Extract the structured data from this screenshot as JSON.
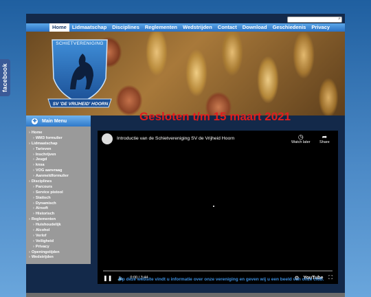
{
  "social": {
    "facebook_label": "facebook"
  },
  "search": {
    "placeholder": ""
  },
  "nav": {
    "items": [
      "Home",
      "Lidmaatschap",
      "Disciplines",
      "Reglementen",
      "Wedstrijden",
      "Contact",
      "Download",
      "Geschiedenis",
      "Privacy"
    ],
    "active": "Home"
  },
  "crest": {
    "top_text": "SCHIETVERENIGING",
    "ribbon_text": "SV 'DE VRIJHEID' HOORN"
  },
  "sidebar": {
    "title": "Main Menu",
    "items": [
      {
        "label": "Home",
        "level": 0
      },
      {
        "label": "WM3 formulier",
        "level": 1
      },
      {
        "label": "Lidmaatschap",
        "level": 0
      },
      {
        "label": "Tarieven",
        "level": 1
      },
      {
        "label": "Inschrijven",
        "level": 1
      },
      {
        "label": "Jeugd",
        "level": 1
      },
      {
        "label": "knsa",
        "level": 1
      },
      {
        "label": "VOG aanvraag",
        "level": 1
      },
      {
        "label": "Aanmeldformulier",
        "level": 1
      },
      {
        "label": "Disciplines",
        "level": 0
      },
      {
        "label": "Parcours",
        "level": 1
      },
      {
        "label": "Service pistool",
        "level": 1
      },
      {
        "label": "Statisch",
        "level": 1
      },
      {
        "label": "Dynamisch",
        "level": 1
      },
      {
        "label": "Airsoft",
        "level": 1
      },
      {
        "label": "Historisch",
        "level": 1
      },
      {
        "label": "Reglementen",
        "level": 0
      },
      {
        "label": "Huishoudelijk",
        "level": 1
      },
      {
        "label": "Alcohol",
        "level": 1
      },
      {
        "label": "Verlof",
        "level": 1
      },
      {
        "label": "Veiligheid",
        "level": 1
      },
      {
        "label": "Privacy",
        "level": 1
      },
      {
        "label": "Openingstijden",
        "level": 0
      },
      {
        "label": "Wedstrijden",
        "level": 0
      }
    ]
  },
  "main": {
    "notice": "Gesloten t/m 15 maart 2021",
    "caption": "Op deze website vindt u informatie over onze vereniging en geven wij u een beeld van onze club."
  },
  "video": {
    "title": "Introductie van de Schietvereniging SV de Vrijheid Hoorn",
    "watch_later": "Watch later",
    "share": "Share",
    "time": "0:00 / 3:44",
    "brand": "YouTube",
    "progress": 0
  },
  "icons": {
    "watch_later": "clock-icon",
    "share": "share-icon",
    "play": "play-icon",
    "volume": "volume-icon",
    "settings": "gear-icon",
    "fullscreen": "fullscreen-icon"
  }
}
